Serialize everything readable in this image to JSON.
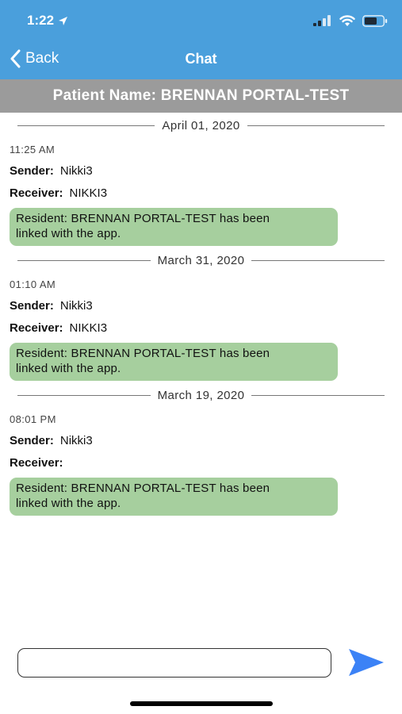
{
  "status_bar": {
    "time": "1:22",
    "icons": [
      "location-arrow-icon",
      "cellular-signal-icon",
      "wifi-icon",
      "battery-icon"
    ]
  },
  "nav": {
    "back_label": "Back",
    "title": "Chat"
  },
  "patient_bar": {
    "text": "Patient Name: BRENNAN PORTAL-TEST"
  },
  "conversation": [
    {
      "date": "April 01, 2020",
      "time": "11:25 AM",
      "sender_label": "Sender:",
      "sender": "Nikki3",
      "receiver_label": "Receiver:",
      "receiver": "NIKKI3",
      "message_line1": "Resident: BRENNAN  PORTAL-TEST has been",
      "message_line2": "linked with the app."
    },
    {
      "date": "March 31, 2020",
      "time": "01:10 AM",
      "sender_label": "Sender:",
      "sender": "Nikki3",
      "receiver_label": "Receiver:",
      "receiver": "NIKKI3",
      "message_line1": "Resident: BRENNAN  PORTAL-TEST has been",
      "message_line2": "linked with the app."
    },
    {
      "date": "March 19, 2020",
      "time": "08:01 PM",
      "sender_label": "Sender:",
      "sender": "Nikki3",
      "receiver_label": "Receiver:",
      "receiver": "",
      "message_line1": "Resident: BRENNAN  PORTAL-TEST has been",
      "message_line2": "linked with the app."
    }
  ],
  "composer": {
    "value": "",
    "placeholder": ""
  },
  "colors": {
    "header_blue": "#4a9fdc",
    "patient_bar_gray": "#9b9b9b",
    "bubble_green": "#a6cf9e",
    "send_blue": "#3b82f6"
  }
}
